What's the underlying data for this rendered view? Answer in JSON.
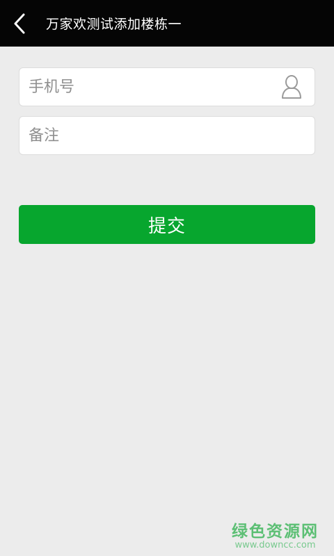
{
  "app_bar": {
    "title": "万家欢测试添加楼栋一",
    "back_icon": "chevron-left-icon"
  },
  "form": {
    "phone": {
      "placeholder": "手机号",
      "value": "",
      "icon": "person-icon"
    },
    "note": {
      "placeholder": "备注",
      "value": ""
    },
    "submit_label": "提交"
  },
  "watermark": {
    "name": "绿色资源网",
    "url": "www.downcc.com"
  },
  "colors": {
    "app_bar": "#050505",
    "background": "#ececec",
    "accent": "#07a62e",
    "input_bg": "#ffffff"
  }
}
